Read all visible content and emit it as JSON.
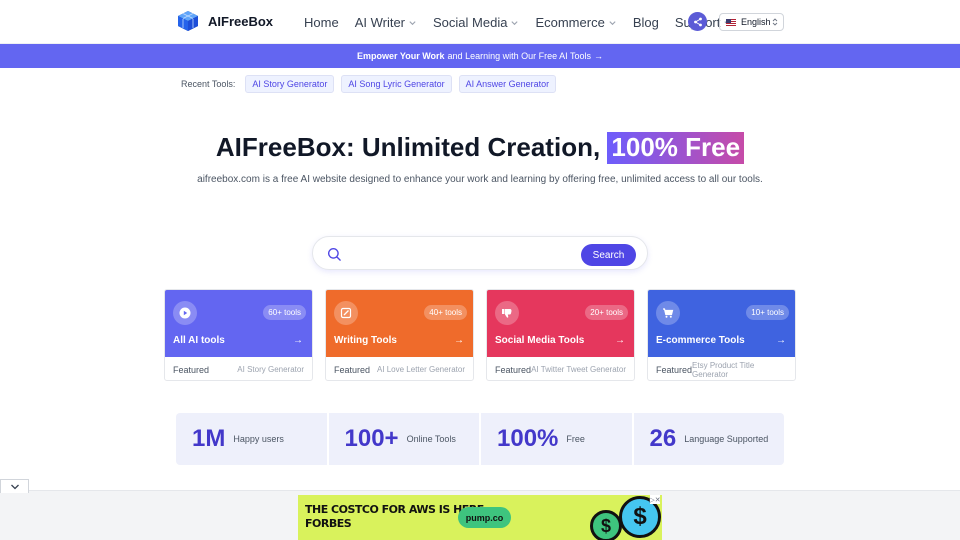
{
  "header": {
    "brand": "AIFreeBox",
    "nav": [
      {
        "label": "Home",
        "dropdown": false
      },
      {
        "label": "AI Writer",
        "dropdown": true
      },
      {
        "label": "Social Media",
        "dropdown": true
      },
      {
        "label": "Ecommerce",
        "dropdown": true
      },
      {
        "label": "Blog",
        "dropdown": false
      },
      {
        "label": "Support",
        "dropdown": true
      }
    ],
    "language": "English",
    "share_icon": "share-icon"
  },
  "banner": {
    "strong": "Empower Your Work",
    "rest": "and Learning with Our Free AI Tools",
    "arrow": "→"
  },
  "recent": {
    "label": "Recent Tools:",
    "tools": [
      "AI Story Generator",
      "AI Song Lyric Generator",
      "AI Answer Generator"
    ]
  },
  "hero": {
    "title_main": "AIFreeBox: Unlimited Creation,",
    "title_highlight": "100% Free",
    "subtitle": "aifreebox.com is a free AI website designed to enhance your work and learning by offering free, unlimited access to all our tools."
  },
  "search": {
    "placeholder": "",
    "value": "",
    "button": "Search"
  },
  "cards": [
    {
      "title": "All AI tools",
      "badge": "60+ tools",
      "featured_label": "Featured",
      "featured_tool": "AI Story Generator",
      "color": "#6366f1",
      "icon": "play-icon"
    },
    {
      "title": "Writing Tools",
      "badge": "40+ tools",
      "featured_label": "Featured",
      "featured_tool": "AI Love Letter Generator",
      "color": "#ef6b2b",
      "icon": "edit-icon"
    },
    {
      "title": "Social Media Tools",
      "badge": "20+ tools",
      "featured_label": "Featured",
      "featured_tool": "AI Twitter Tweet Generator",
      "color": "#e5375d",
      "icon": "thumbs-down-icon"
    },
    {
      "title": "E-commerce Tools",
      "badge": "10+ tools",
      "featured_label": "Featured",
      "featured_tool": "Etsy Product Title Generator",
      "color": "#3f63e0",
      "icon": "cart-icon"
    }
  ],
  "card_arrow": "→",
  "stats": [
    {
      "num": "1M",
      "label": "Happy users"
    },
    {
      "num": "100+",
      "label": "Online Tools"
    },
    {
      "num": "100%",
      "label": "Free"
    },
    {
      "num": "26",
      "label": "Language Supported"
    }
  ],
  "ad": {
    "line1": "THE COSTCO FOR AWS IS HERE –",
    "line2": "FORBES",
    "pill": "pump.co",
    "coin": "$",
    "close": "▷✕"
  }
}
